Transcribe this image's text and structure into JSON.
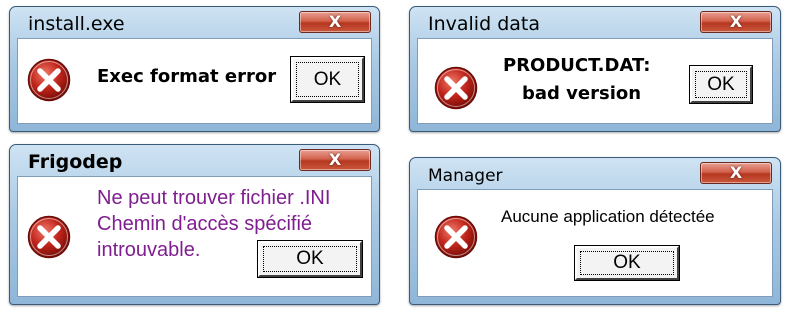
{
  "colors": {
    "error_red": "#c0251b",
    "purple_text": "#7f1e8f",
    "frame_blue": "#a9c9e4"
  },
  "dialogs": [
    {
      "title": "install.exe",
      "message": "Exec format error",
      "ok_label": "OK",
      "close_label": "X",
      "icon": "error-icon"
    },
    {
      "title": "Invalid data",
      "message_line1": "PRODUCT.DAT:",
      "message_line2": "bad version",
      "ok_label": "OK",
      "close_label": "X",
      "icon": "error-icon"
    },
    {
      "title": "Frigodep",
      "message_line1": "Ne peut trouver fichier .INI",
      "message_line2": "Chemin d'accès spécifié",
      "message_line3": "introuvable.",
      "ok_label": "OK",
      "close_label": "X",
      "icon": "error-icon"
    },
    {
      "title": "Manager",
      "message": "Aucune application détectée",
      "ok_label": "OK",
      "close_label": "X",
      "icon": "error-icon"
    }
  ]
}
